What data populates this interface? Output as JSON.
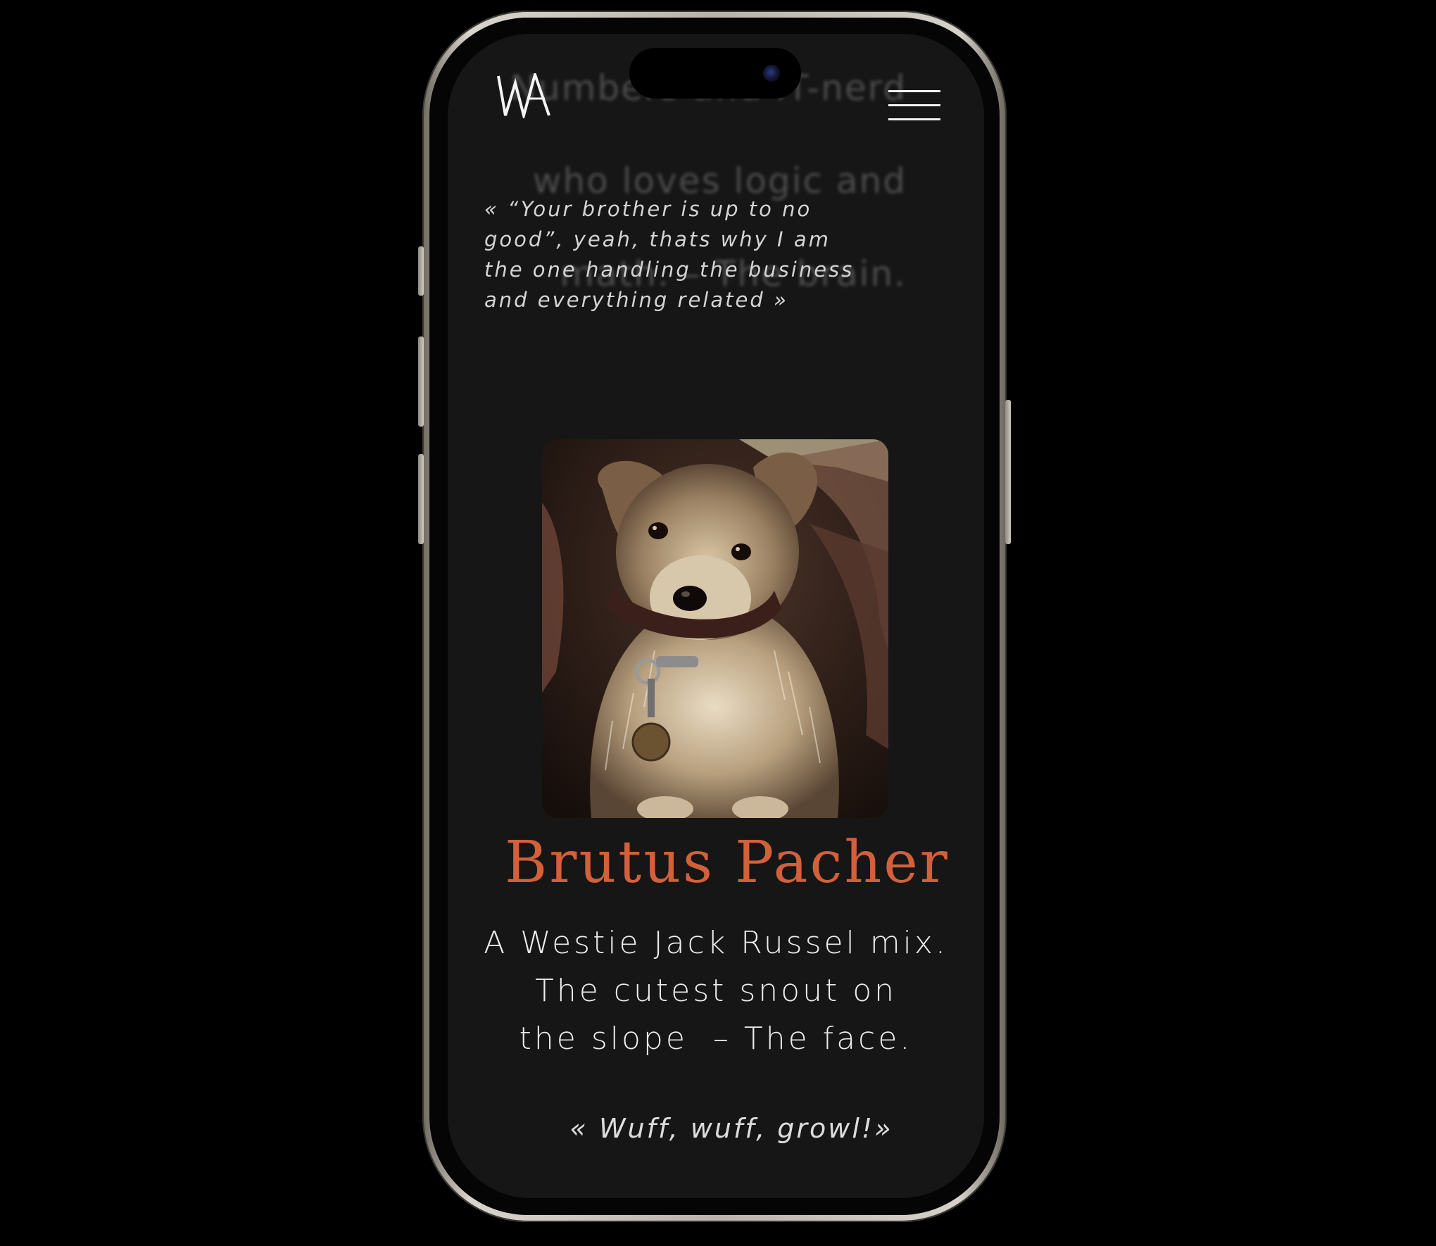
{
  "header": {
    "logo_text": "WA",
    "background_text_lines": [
      "Numbers and IT-nerd",
      "who loves logic and",
      "math. – The brain."
    ]
  },
  "profile_previous": {
    "quote": "« “Your brother is up to no good”, yeah, thats why I am the one handling the business and everything related »"
  },
  "profile": {
    "photo_subject": "Westie Jack Russel mix dog portrait",
    "name": "Brutus Pacher",
    "description_lines": [
      "A Westie Jack Russel mix.",
      "The cutest snout on",
      "the slope  – The face."
    ],
    "quote": "« Wuff, wuff, growl!»"
  },
  "colors": {
    "background": "#161616",
    "accent_name": "#d2603a",
    "text": "#ececec"
  },
  "icons": [
    "menu-icon",
    "camera-icon",
    "logo"
  ]
}
